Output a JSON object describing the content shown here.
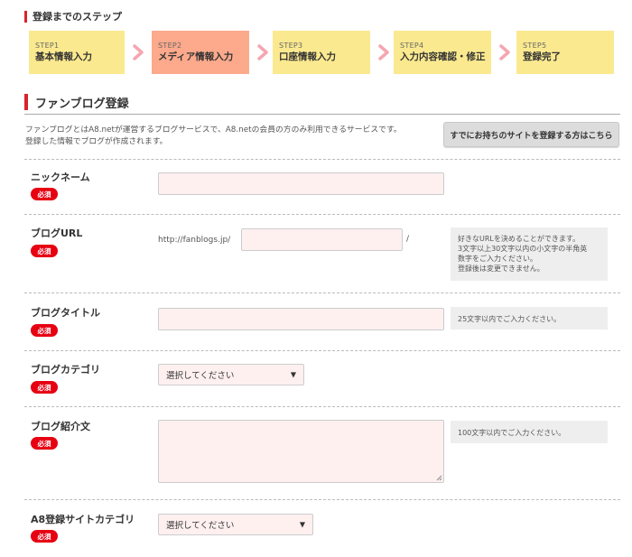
{
  "steps_heading": "登録までのステップ",
  "steps": [
    {
      "num": "STEP1",
      "label": "基本情報入力",
      "active": false
    },
    {
      "num": "STEP2",
      "label": "メディア情報入力",
      "active": true
    },
    {
      "num": "STEP3",
      "label": "口座情報入力",
      "active": false
    },
    {
      "num": "STEP4",
      "label": "入力内容確認・修正",
      "active": false
    },
    {
      "num": "STEP5",
      "label": "登録完了",
      "active": false
    }
  ],
  "section_title": "ファンブログ登録",
  "intro": [
    "ファンブログとはA8.netが運営するブログサービスで、A8.netの会員の方のみ利用できるサービスです。",
    "登録した情報でブログが作成されます。"
  ],
  "existing_site_button": "すでにお持ちのサイトを登録する方はこちら",
  "required_badge": "必須",
  "fields": {
    "nickname": {
      "label": "ニックネーム"
    },
    "blog_url": {
      "label": "ブログURL",
      "prefix": "http://fanblogs.jp/",
      "suffix": "/",
      "note": [
        "好きなURLを決めることができます。",
        "3文字以上30文字以内の小文字の半角英",
        "数字をご入力ください。",
        "登録後は変更できません。"
      ]
    },
    "blog_title": {
      "label": "ブログタイトル",
      "note": "25文字以内でご入力ください。"
    },
    "blog_category": {
      "label": "ブログカテゴリ",
      "selected": "選択してください",
      "arrow": "▼"
    },
    "blog_intro": {
      "label": "ブログ紹介文",
      "note": "100文字以内でご入力ください。"
    },
    "a8_category": {
      "label": "A8登録サイトカテゴリ",
      "selected": "選択してください",
      "arrow": "▼"
    }
  },
  "colors": {
    "accent_red": "#d9232d",
    "required_red": "#e60012",
    "step_yellow": "#fbe98f",
    "step_active": "#fca98c",
    "chevron_pink": "#f4a6b1",
    "input_bg": "#fff0f0"
  },
  "icons": {
    "step_arrow": "chevron-right-icon",
    "select_arrow": "triangle-down-icon"
  }
}
